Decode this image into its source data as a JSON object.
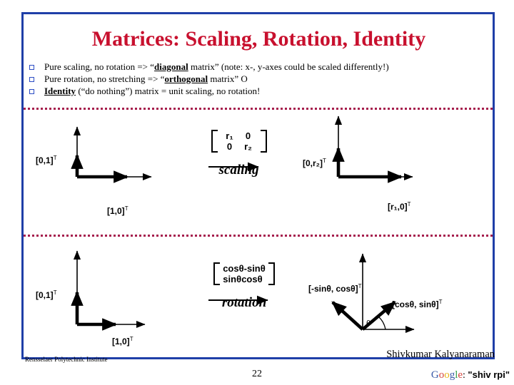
{
  "slide": {
    "title": "Matrices: Scaling, Rotation, Identity",
    "page_number": "22",
    "title_color": "#C8102E",
    "frame_color": "#1F3FA8",
    "separator_color": "#A61E4D"
  },
  "bullets": [
    {
      "marker": "square-bullet",
      "segments": [
        {
          "text": "Pure scaling, no rotation => “",
          "style": "normal"
        },
        {
          "text": "diagonal",
          "style": "underline-bold"
        },
        {
          "text": " matrix” (note: x-, y-axes could be scaled differently!)",
          "style": "normal"
        }
      ],
      "plain": "Pure scaling, no rotation => “diagonal matrix” (note: x-, y-axes could be scaled differently!)"
    },
    {
      "marker": "square-bullet",
      "segments": [
        {
          "text": "Pure rotation, no stretching => “",
          "style": "normal"
        },
        {
          "text": "orthogonal",
          "style": "underline-bold"
        },
        {
          "text": " matrix” O",
          "style": "normal"
        }
      ],
      "plain": "Pure rotation, no stretching => “orthogonal matrix” O"
    },
    {
      "marker": "square-bullet",
      "segments": [
        {
          "text": "Identity",
          "style": "underline-bold"
        },
        {
          "text": " (“do nothing”) matrix = unit scaling, no rotation!",
          "style": "normal"
        }
      ],
      "plain": "Identity (“do nothing”) matrix = unit scaling, no rotation!"
    }
  ],
  "scaling_panel": {
    "input_labels": {
      "y_vector": "[0,1]",
      "y_vector_sup": "T",
      "x_vector": "[1,0]",
      "x_vector_sup": "T"
    },
    "matrix": {
      "rows": [
        [
          "r₁",
          "0"
        ],
        [
          "0",
          "r₂"
        ]
      ],
      "operation_label": "scaling"
    },
    "output_labels": {
      "y_vector": "[0,r₂]",
      "y_vector_sup": "T",
      "x_vector": "[r₁,0]",
      "x_vector_sup": "T"
    }
  },
  "rotation_panel": {
    "input_labels": {
      "y_vector": "[0,1]",
      "y_vector_sup": "T",
      "x_vector": "[1,0]",
      "x_vector_sup": "T"
    },
    "matrix": {
      "rows": [
        [
          "cosθ",
          "-sinθ"
        ],
        [
          "sinθ",
          "cosθ"
        ]
      ],
      "operation_label": "rotation"
    },
    "output_labels": {
      "y_vector": "[-sinθ, cosθ]",
      "y_vector_sup": "T",
      "x_vector": "[cosθ, sinθ]",
      "x_vector_sup": "T",
      "angle_symbol": "θ"
    }
  },
  "footer": {
    "institute": "Rensselaer Polytechnic Institute",
    "author": "Shivkumar Kalyanaraman",
    "google_letters": [
      "G",
      "o",
      "o",
      "g",
      "l",
      "e"
    ],
    "google_suffix": ": ",
    "google_query": "\"shiv rpi\""
  }
}
